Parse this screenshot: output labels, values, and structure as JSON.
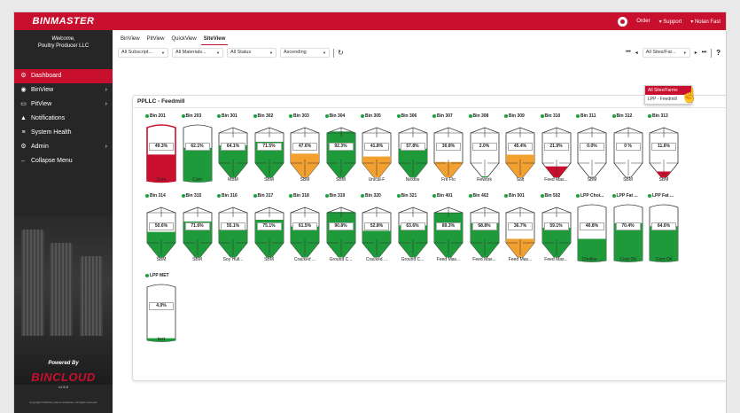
{
  "brand": {
    "logo": "BINMASTER",
    "powered_by": "Powered By",
    "cloud": "BINCLOUD",
    "version": "v1.5.0",
    "copyright": "Copyright ©2023 by Garner Industries. All rights reserved."
  },
  "user": {
    "welcome": "Welcome,",
    "org": "Poultry Producer LLC",
    "name": "▾ Nolan Fast"
  },
  "topbar": {
    "order": "Order",
    "support": "▾ Support"
  },
  "nav": [
    {
      "label": "Dashboard",
      "icon": "⚙",
      "active": true,
      "chev": ""
    },
    {
      "label": "BinView",
      "icon": "◉",
      "active": false,
      "chev": "›"
    },
    {
      "label": "PitView",
      "icon": "▭",
      "active": false,
      "chev": "›"
    },
    {
      "label": "Notifications",
      "icon": "▲",
      "active": false,
      "chev": ""
    },
    {
      "label": "System Health",
      "icon": "≡",
      "active": false,
      "chev": ""
    },
    {
      "label": "Admin",
      "icon": "⚙",
      "active": false,
      "chev": "›"
    },
    {
      "label": "Collapse Menu",
      "icon": "←",
      "active": false,
      "chev": ""
    }
  ],
  "tabs": [
    "BinView",
    "PitView",
    "QuickView",
    "SiteView"
  ],
  "filters": [
    "All Subscript...",
    "All Materials...",
    "All Status",
    "Ascending"
  ],
  "pager": {
    "site": "All Sites/Far...",
    "first": "⏮",
    "prev": "◂",
    "next": "▸",
    "last": "⏭",
    "help": "?"
  },
  "dropdown": [
    "All Sites/Farms",
    "LPP - Feedmill"
  ],
  "panel": {
    "title": "PPLLC - Feedmill"
  },
  "colors": {
    "green": "#1f9a3a",
    "orange": "#f2a02f",
    "red": "#c8102e"
  },
  "bins": [
    {
      "name": "Bin 201",
      "pct": "49.3%",
      "fill": 0.493,
      "color": "red",
      "content": "Corn",
      "shape": "flat",
      "selected": true
    },
    {
      "name": "Bin 203",
      "pct": "62.1%",
      "fill": 0.621,
      "color": "green",
      "content": "Corn",
      "shape": "flat"
    },
    {
      "name": "Bin 301",
      "pct": "64.1%",
      "fill": 0.641,
      "color": "green",
      "content": "MBM",
      "shape": "cone"
    },
    {
      "name": "Bin 302",
      "pct": "71.5%",
      "fill": 0.715,
      "color": "green",
      "content": "SBM",
      "shape": "cone"
    },
    {
      "name": "Bin 303",
      "pct": "47.6%",
      "fill": 0.476,
      "color": "orange",
      "content": "SBM",
      "shape": "cone"
    },
    {
      "name": "Bin 304",
      "pct": "92.3%",
      "fill": 0.923,
      "color": "green",
      "content": "SBM",
      "shape": "cone"
    },
    {
      "name": "Bin 305",
      "pct": "41.8%",
      "fill": 0.418,
      "color": "orange",
      "content": "Unical-F",
      "shape": "cone"
    },
    {
      "name": "Bin 306",
      "pct": "57.8%",
      "fill": 0.578,
      "color": "green",
      "content": "Nextos",
      "shape": "cone"
    },
    {
      "name": "Bin 307",
      "pct": "30.8%",
      "fill": 0.308,
      "color": "orange",
      "content": "Fre Flo",
      "shape": "cone"
    },
    {
      "name": "Bin 308",
      "pct": "2.0%",
      "fill": 0.02,
      "color": "green",
      "content": "Rework",
      "shape": "cone"
    },
    {
      "name": "Bin 309",
      "pct": "45.4%",
      "fill": 0.454,
      "color": "orange",
      "content": "Salt",
      "shape": "cone"
    },
    {
      "name": "Bin 310",
      "pct": "21.9%",
      "fill": 0.219,
      "color": "red",
      "content": "Feed Mas...",
      "shape": "cone"
    },
    {
      "name": "Bin 311",
      "pct": "0.0%",
      "fill": 0.0,
      "color": "green",
      "content": "SBM",
      "shape": "cone"
    },
    {
      "name": "Bin 312",
      "pct": "0 %",
      "fill": 0.0,
      "color": "green",
      "content": "SBM",
      "shape": "cone"
    },
    {
      "name": "Bin 313",
      "pct": "11.6%",
      "fill": 0.116,
      "color": "red",
      "content": "SBM",
      "shape": "cone"
    },
    {
      "name": "Bin 314",
      "pct": "50.6%",
      "fill": 0.506,
      "color": "green",
      "content": "SBM",
      "shape": "cone"
    },
    {
      "name": "Bin 315",
      "pct": "71.6%",
      "fill": 0.716,
      "color": "green",
      "content": "SBM",
      "shape": "cone"
    },
    {
      "name": "Bin 316",
      "pct": "55.1%",
      "fill": 0.551,
      "color": "green",
      "content": "Soy Hull...",
      "shape": "cone"
    },
    {
      "name": "Bin 317",
      "pct": "75.1%",
      "fill": 0.751,
      "color": "green",
      "content": "SBM",
      "shape": "cone"
    },
    {
      "name": "Bin 318",
      "pct": "61.5%",
      "fill": 0.615,
      "color": "green",
      "content": "Cracked ...",
      "shape": "cone"
    },
    {
      "name": "Bin 319",
      "pct": "90.8%",
      "fill": 0.908,
      "color": "green",
      "content": "Ground C...",
      "shape": "cone"
    },
    {
      "name": "Bin 320",
      "pct": "52.8%",
      "fill": 0.528,
      "color": "green",
      "content": "Cracked ...",
      "shape": "cone"
    },
    {
      "name": "Bin 321",
      "pct": "63.6%",
      "fill": 0.636,
      "color": "green",
      "content": "Ground C...",
      "shape": "cone"
    },
    {
      "name": "Bin 401",
      "pct": "89.3%",
      "fill": 0.893,
      "color": "green",
      "content": "Feed Mas...",
      "shape": "cone"
    },
    {
      "name": "Bin 402",
      "pct": "68.8%",
      "fill": 0.688,
      "color": "green",
      "content": "Feed Mas...",
      "shape": "cone"
    },
    {
      "name": "Bin 501",
      "pct": "36.7%",
      "fill": 0.367,
      "color": "orange",
      "content": "Feed Mas...",
      "shape": "cone"
    },
    {
      "name": "Bin 502",
      "pct": "59.1%",
      "fill": 0.591,
      "color": "green",
      "content": "Feed Mas...",
      "shape": "cone"
    },
    {
      "name": "LPP Choi...",
      "pct": "40.8%",
      "fill": 0.408,
      "color": "green",
      "content": "Choline ...",
      "shape": "flat"
    },
    {
      "name": "LPP Fat ...",
      "pct": "70.4%",
      "fill": 0.704,
      "color": "green",
      "content": "Corn Oil",
      "shape": "flat"
    },
    {
      "name": "LPP Fat ...",
      "pct": "64.6%",
      "fill": 0.646,
      "color": "green",
      "content": "Corn Oil",
      "shape": "flat"
    },
    {
      "name": "LPP MET",
      "pct": "4.0%",
      "fill": 0.04,
      "color": "green",
      "content": "test",
      "shape": "flat"
    }
  ]
}
